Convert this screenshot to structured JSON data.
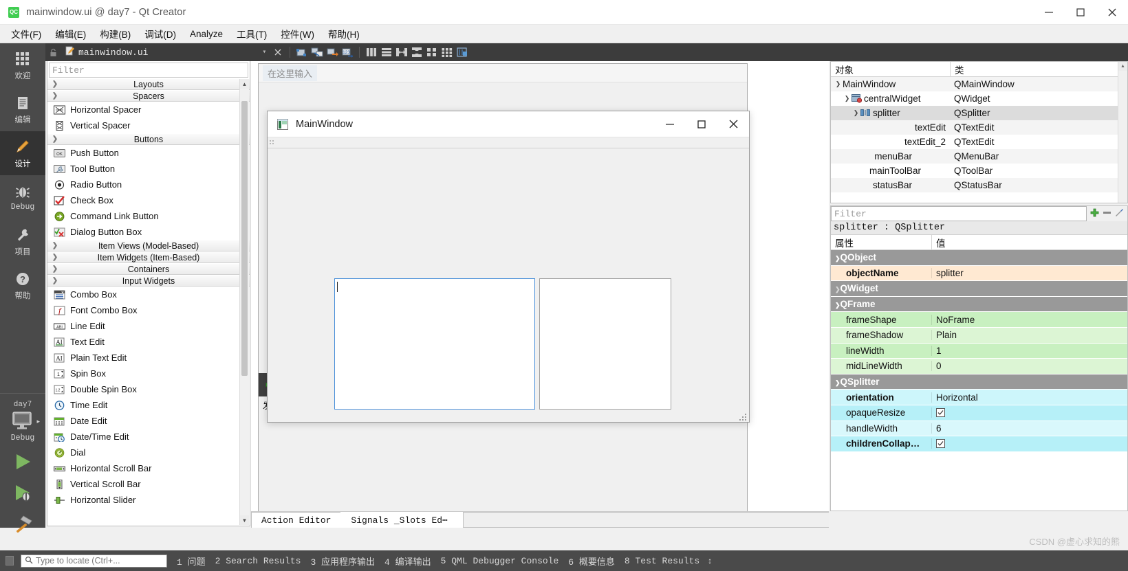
{
  "window": {
    "title": "mainwindow.ui @ day7 - Qt Creator",
    "logo_text": "QC",
    "minimize": "minimize-icon",
    "maximize": "maximize-icon",
    "close": "close-icon"
  },
  "menubar": {
    "items": [
      {
        "label": "文件(F)",
        "mnemonic": "F"
      },
      {
        "label": "编辑(E)",
        "mnemonic": "E"
      },
      {
        "label": "构建(B)",
        "mnemonic": "B"
      },
      {
        "label": "调试(D)",
        "mnemonic": "D"
      },
      {
        "label": "Analyze",
        "mnemonic": "A"
      },
      {
        "label": "工具(T)",
        "mnemonic": "T"
      },
      {
        "label": "控件(W)",
        "mnemonic": "W"
      },
      {
        "label": "帮助(H)",
        "mnemonic": "H"
      }
    ]
  },
  "modebar": {
    "modes": [
      {
        "label": "欢迎",
        "icon": "grid-icon",
        "active": false
      },
      {
        "label": "编辑",
        "icon": "document-icon",
        "active": false
      },
      {
        "label": "设计",
        "icon": "pencil-icon",
        "active": true
      },
      {
        "label": "Debug",
        "icon": "bug-icon",
        "active": false
      },
      {
        "label": "项目",
        "icon": "wrench-icon",
        "active": false
      },
      {
        "label": "帮助",
        "icon": "question-icon",
        "active": false
      }
    ],
    "kit": {
      "project": "day7",
      "config": "Debug",
      "icon": "monitor-icon"
    },
    "run_buttons": [
      {
        "name": "run-button",
        "icon": "play-icon"
      },
      {
        "name": "debug-button",
        "icon": "play-bug-icon"
      },
      {
        "name": "build-button",
        "icon": "hammer-icon"
      }
    ]
  },
  "tabstrip": {
    "lock_icon": "unlocked-icon",
    "file_icon": "file-edit-icon",
    "filename": "mainwindow.ui",
    "dropdown_icon": "chevron-down-icon",
    "close_icon": "close-x-icon",
    "tools": [
      "edit-widgets-icon",
      "edit-signals-slots-icon",
      "edit-buddies-icon",
      "edit-tab-order-icon",
      "layout-horizontal-icon",
      "layout-vertical-icon",
      "layout-splitter-h-icon",
      "layout-splitter-v-icon",
      "layout-form-icon",
      "layout-grid-icon",
      "break-layout-icon"
    ]
  },
  "widgetbox": {
    "filter_placeholder": "Filter",
    "sections": [
      {
        "title": "Layouts",
        "expanded": false,
        "items": []
      },
      {
        "title": "Spacers",
        "expanded": true,
        "items": [
          {
            "label": "Horizontal Spacer",
            "icon": "hspacer-icon"
          },
          {
            "label": "Vertical Spacer",
            "icon": "vspacer-icon"
          }
        ]
      },
      {
        "title": "Buttons",
        "expanded": true,
        "items": [
          {
            "label": "Push Button",
            "icon": "pushbutton-icon"
          },
          {
            "label": "Tool Button",
            "icon": "toolbutton-icon"
          },
          {
            "label": "Radio Button",
            "icon": "radiobutton-icon"
          },
          {
            "label": "Check Box",
            "icon": "checkbox-icon"
          },
          {
            "label": "Command Link Button",
            "icon": "commandlink-icon"
          },
          {
            "label": "Dialog Button Box",
            "icon": "dialogbuttonbox-icon"
          }
        ]
      },
      {
        "title": "Item Views (Model-Based)",
        "expanded": false,
        "items": []
      },
      {
        "title": "Item Widgets (Item-Based)",
        "expanded": false,
        "items": []
      },
      {
        "title": "Containers",
        "expanded": false,
        "items": []
      },
      {
        "title": "Input Widgets",
        "expanded": true,
        "items": [
          {
            "label": "Combo Box",
            "icon": "combobox-icon"
          },
          {
            "label": "Font Combo Box",
            "icon": "fontcombobox-icon"
          },
          {
            "label": "Line Edit",
            "icon": "lineedit-icon"
          },
          {
            "label": "Text Edit",
            "icon": "textedit-icon"
          },
          {
            "label": "Plain Text Edit",
            "icon": "plaintextedit-icon"
          },
          {
            "label": "Spin Box",
            "icon": "spinbox-icon"
          },
          {
            "label": "Double Spin Box",
            "icon": "doublespinbox-icon"
          },
          {
            "label": "Time Edit",
            "icon": "timeedit-icon"
          },
          {
            "label": "Date Edit",
            "icon": "dateedit-icon"
          },
          {
            "label": "Date/Time Edit",
            "icon": "datetimeedit-icon"
          },
          {
            "label": "Dial",
            "icon": "dial-icon"
          },
          {
            "label": "Horizontal Scroll Bar",
            "icon": "hscrollbar-icon"
          },
          {
            "label": "Vertical Scroll Bar",
            "icon": "vscrollbar-icon"
          },
          {
            "label": "Horizontal Slider",
            "icon": "hslider-icon"
          }
        ]
      }
    ]
  },
  "canvas": {
    "menu_placeholder": "在这里输入",
    "toolbar_add_icon": "plus-icon",
    "send_label": "发送"
  },
  "preview": {
    "title": "MainWindow",
    "icon": "mainwindow-icon",
    "minimize": "minimize-icon",
    "maximize": "maximize-icon",
    "close": "close-icon",
    "menu_placeholder": ""
  },
  "bottom_docks": {
    "tabs": [
      {
        "label": "Action Editor",
        "selected": true
      },
      {
        "label": "Signals _Slots Ed⋯",
        "selected": false
      }
    ]
  },
  "object_tree": {
    "headers": [
      "对象",
      "类"
    ],
    "rows": [
      {
        "indent": 0,
        "chevron": "v",
        "icon": "",
        "name": "MainWindow",
        "class": "QMainWindow",
        "selected": false
      },
      {
        "indent": 1,
        "chevron": "v",
        "icon": "widget-icon",
        "name": "centralWidget",
        "class": "QWidget",
        "selected": false
      },
      {
        "indent": 2,
        "chevron": "v",
        "icon": "splitter-icon",
        "name": "splitter",
        "class": "QSplitter",
        "selected": true
      },
      {
        "indent": 3,
        "chevron": "",
        "icon": "",
        "name": "textEdit",
        "class": "QTextEdit",
        "selected": false
      },
      {
        "indent": 3,
        "chevron": "",
        "icon": "",
        "name": "textEdit_2",
        "class": "QTextEdit",
        "selected": false
      },
      {
        "indent": 1,
        "chevron": "",
        "icon": "",
        "name": "menuBar",
        "class": "QMenuBar",
        "selected": false
      },
      {
        "indent": 1,
        "chevron": "",
        "icon": "",
        "name": "mainToolBar",
        "class": "QToolBar",
        "selected": false
      },
      {
        "indent": 1,
        "chevron": "",
        "icon": "",
        "name": "statusBar",
        "class": "QStatusBar",
        "selected": false
      }
    ]
  },
  "property_editor": {
    "filter_placeholder": "Filter",
    "tools": [
      "add-icon",
      "remove-icon",
      "configure-icon"
    ],
    "object_line": "splitter : QSplitter",
    "headers": [
      "属性",
      "值"
    ],
    "rows": [
      {
        "type": "group",
        "chevron": "v",
        "name": "QObject",
        "value": ""
      },
      {
        "type": "prop",
        "name": "objectName",
        "value": "splitter",
        "bold": true,
        "bg": "#ffe9d2"
      },
      {
        "type": "group",
        "chevron": ">",
        "name": "QWidget",
        "value": ""
      },
      {
        "type": "group",
        "chevron": "v",
        "name": "QFrame",
        "value": ""
      },
      {
        "type": "prop",
        "name": "frameShape",
        "value": "NoFrame",
        "bold": false,
        "bg": "#c8f0c0"
      },
      {
        "type": "prop",
        "name": "frameShadow",
        "value": "Plain",
        "bold": false,
        "bg": "#dcf5d4"
      },
      {
        "type": "prop",
        "name": "lineWidth",
        "value": "1",
        "bold": false,
        "bg": "#c8f0c0"
      },
      {
        "type": "prop",
        "name": "midLineWidth",
        "value": "0",
        "bold": false,
        "bg": "#dcf5d4"
      },
      {
        "type": "group",
        "chevron": "v",
        "name": "QSplitter",
        "value": ""
      },
      {
        "type": "prop",
        "name": "orientation",
        "value": "Horizontal",
        "bold": true,
        "bg": "#cdf6fb"
      },
      {
        "type": "check",
        "name": "opaqueResize",
        "value": true,
        "bold": false,
        "bg": "#b6f0f8"
      },
      {
        "type": "prop",
        "name": "handleWidth",
        "value": "6",
        "bold": false,
        "bg": "#d9f8fc"
      },
      {
        "type": "check",
        "name": "childrenCollap…",
        "value": true,
        "bold": true,
        "bg": "#b6f0f8"
      }
    ]
  },
  "statusbar": {
    "locate_placeholder": "Type to locate (Ctrl+...",
    "search_icon": "search-icon",
    "items": [
      "1 问题",
      "2 Search Results",
      "3 应用程序输出",
      "4 编译输出",
      "5 QML Debugger Console",
      "6 概要信息",
      "8 Test Results"
    ],
    "updown_icon": "updown-arrows-icon"
  },
  "watermark": "CSDN @虚心求知的熊"
}
